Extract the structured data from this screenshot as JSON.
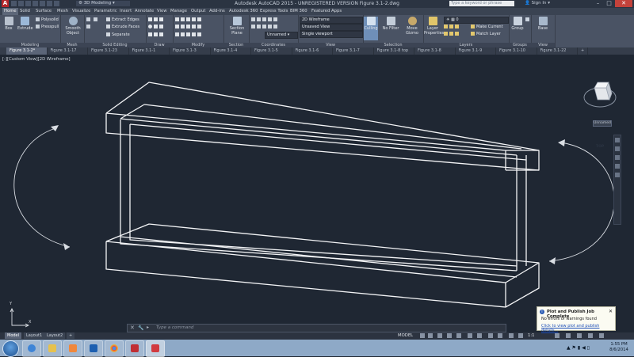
{
  "app": {
    "title": "Autodesk AutoCAD 2015 - UNREGISTERED VERSION    Figure 3.1-2.dwg",
    "workspace": "3D Modeling",
    "search_placeholder": "Type a keyword or phrase",
    "sign_in": "Sign In"
  },
  "ribbon_tabs": [
    "Home",
    "Solid",
    "Surface",
    "Mesh",
    "Visualize",
    "Parametric",
    "Insert",
    "Annotate",
    "View",
    "Manage",
    "Output",
    "Add-ins",
    "Autodesk 360",
    "Express Tools",
    "BIM 360",
    "Featured Apps"
  ],
  "ribbon": {
    "modeling": {
      "label": "Modeling",
      "box": "Box",
      "extrude": "Extrude",
      "polysolid": "Polysolid",
      "presspull": "Presspull"
    },
    "mesh": {
      "label": "Mesh",
      "smooth_object": "Smooth Object"
    },
    "solid_editing": {
      "label": "Solid Editing",
      "extract_edges": "Extract Edges",
      "extrude_faces": "Extrude Faces",
      "separate": "Separate"
    },
    "draw": {
      "label": "Draw"
    },
    "modify": {
      "label": "Modify"
    },
    "section": {
      "label": "Section",
      "section_plane": "Section Plane"
    },
    "coordinates": {
      "label": "Coordinates",
      "ucs": "Unnamed"
    },
    "view": {
      "label": "View",
      "visual_style": "2D Wireframe",
      "named_view": "Unsaved View",
      "viewport": "Single viewport"
    },
    "selection": {
      "label": "Selection",
      "culling": "Culling",
      "no_filter": "No Filter",
      "move_gizmo": "Move Gizmo"
    },
    "layers": {
      "label": "Layers",
      "layer_properties": "Layer Properties",
      "current_layer": "0",
      "make_current": "Make Current",
      "match_layer": "Match Layer"
    },
    "groups": {
      "label": "Groups",
      "group": "Group"
    },
    "view2": {
      "label": "View",
      "base": "Base"
    }
  },
  "file_tabs": [
    "Figure 3.1-2*",
    "Figure 3.1-17",
    "Figure 3.1-23",
    "Figure 3.1-1",
    "Figure 3.1-3",
    "Figure 3.1-4",
    "Figure 3.1-5",
    "Figure 3.1-6",
    "Figure 3.1-7",
    "Figure 3.1-8 top view",
    "Figure 3.1-8",
    "Figure 3.1-9",
    "Figure 3.1-10",
    "Figure 3.1-22"
  ],
  "viewport": {
    "label": "[-][Custom View][2D Wireframe]",
    "cube_face": "TOP",
    "ucs_name": "Unnamed",
    "ucs_x": "X",
    "ucs_y": "Y"
  },
  "command_line": {
    "placeholder": "Type a command"
  },
  "layout_tabs": [
    "Model",
    "Layout1",
    "Layout2"
  ],
  "status": {
    "model": "MODEL",
    "scale": "1:1"
  },
  "notification": {
    "title": "Plot and Publish Job Complete",
    "body": "No errors or warnings found",
    "link": "Click to view plot and publish details..."
  },
  "taskbar": {
    "time": "1:55 PM",
    "date": "8/6/2014"
  },
  "colors": {
    "accent": "#b5262b",
    "ribbon": "#4a5364",
    "viewport": "#1f2733",
    "taskbar": "#8ea9c7"
  }
}
